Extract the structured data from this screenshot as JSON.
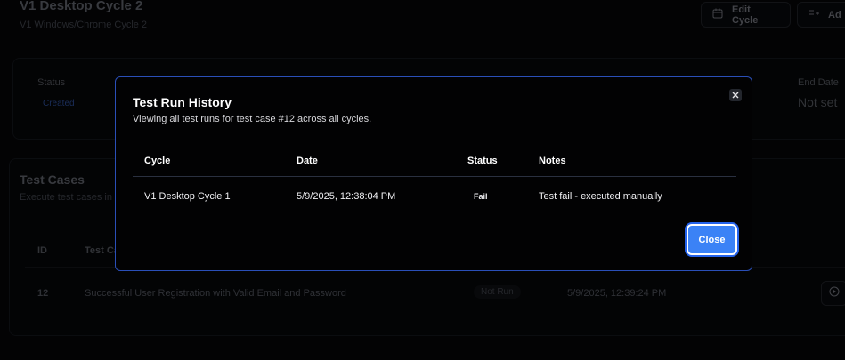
{
  "background": {
    "cycle_title": "V1 Desktop Cycle 2",
    "cycle_subtitle": "V1 Windows/Chrome Cycle 2",
    "edit_cycle_label": "Edit Cycle",
    "add_label": "Ad",
    "status_label": "Status",
    "status_value": "Created",
    "end_date_label": "End Date",
    "end_date_value": "Not set",
    "test_cases_title": "Test Cases",
    "test_cases_subtitle": "Execute test cases in t",
    "col_id": "ID",
    "col_test_case": "Test Ca",
    "row": {
      "id": "12",
      "name": "Successful User Registration with Valid Email and Password",
      "status": "Not Run",
      "date": "5/9/2025, 12:39:24 PM"
    }
  },
  "dialog": {
    "title": "Test Run History",
    "description": "Viewing all test runs for test case #12 across all cycles.",
    "columns": [
      "Cycle",
      "Date",
      "Status",
      "Notes"
    ],
    "rows": [
      {
        "cycle": "V1 Desktop Cycle 1",
        "date": "5/9/2025, 12:38:04 PM",
        "status": "Fail",
        "notes": "Test fail - executed manually"
      }
    ],
    "close_label": "Close"
  },
  "colors": {
    "accent": "#3b82f6",
    "dialog_border": "#2a4fb8",
    "background": "#050507"
  },
  "icons": {
    "edit": "calendar-icon",
    "add": "list-add-icon",
    "play": "play-circle-icon",
    "close": "close-icon"
  }
}
